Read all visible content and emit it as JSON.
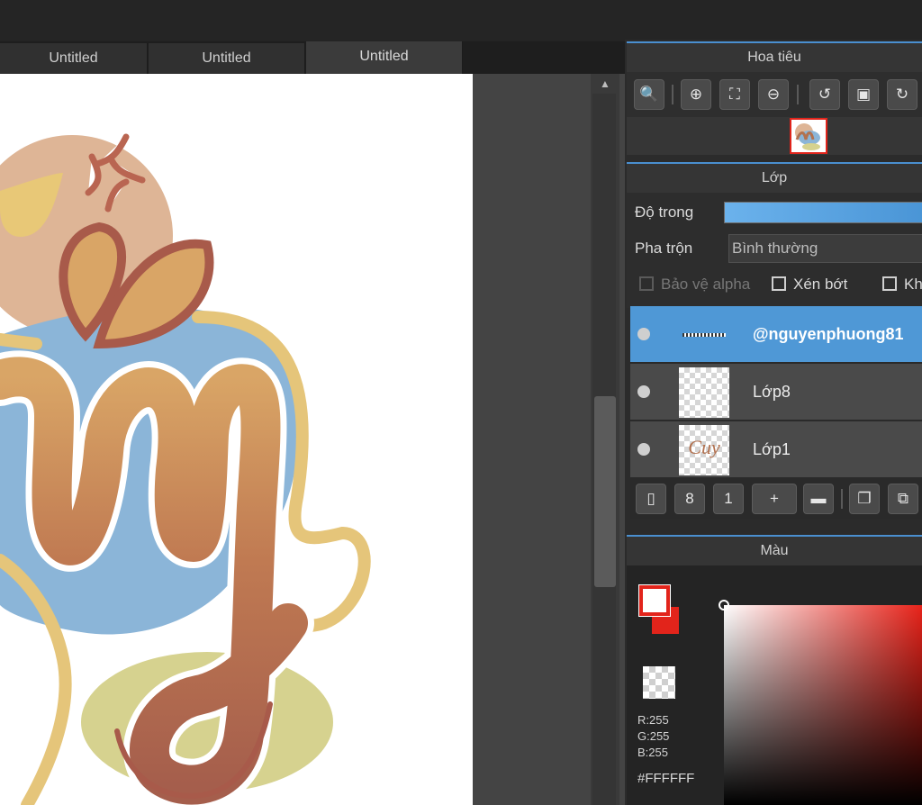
{
  "tabs": [
    {
      "label": "Untitled"
    },
    {
      "label": "Untitled"
    },
    {
      "label": "Untitled"
    }
  ],
  "navigator": {
    "title": "Hoa tiêu"
  },
  "layer_panel": {
    "title": "Lớp",
    "opacity_label": "Độ trong",
    "opacity_value": 1.0,
    "blend_label": "Pha trộn",
    "blend_value": "Bình thường",
    "protect_alpha_label": "Bảo vệ alpha",
    "clipping_label": "Xén bớt",
    "lock_label_partial": "Kh",
    "layers": [
      {
        "name": "@nguyenphuong81",
        "selected": true
      },
      {
        "name": "Lớp8",
        "selected": false
      },
      {
        "name": "Lớp1",
        "selected": false,
        "thumb_text": "Cuy"
      }
    ]
  },
  "color_panel": {
    "title": "Màu",
    "r": "R:255",
    "g": "G:255",
    "b": "B:255",
    "hex": "#FFFFFF",
    "foreground": "#ffffff",
    "background": "#e2241b"
  },
  "scrollbar": {
    "up_arrow": "▲"
  },
  "icons": {
    "zoom_actual": "🔍",
    "zoom_in": "⊕",
    "fit": "⛶",
    "zoom_out": "⊖",
    "rotate_left": "↺",
    "fullscreen": "▣",
    "rotate_right": "↻",
    "new_layer": "▯",
    "new_8bit": "8",
    "new_1bit": "1",
    "add_layer": "+",
    "folder": "▬",
    "duplicate": "❐",
    "merge": "⧉",
    "palette": "🎨",
    "palette_settings": "⚙"
  }
}
